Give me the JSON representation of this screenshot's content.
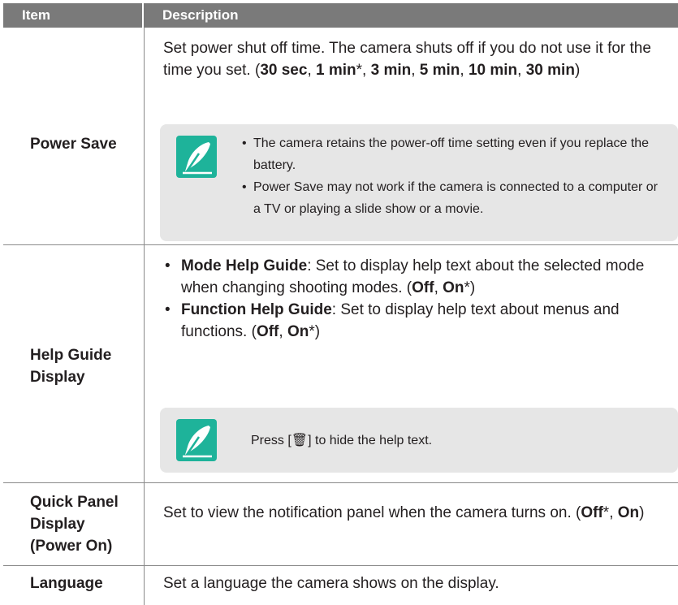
{
  "header": {
    "item": "Item",
    "description": "Description"
  },
  "rows": [
    {
      "label": "Power Save",
      "desc_parts": [
        "Set power shut off time. The camera shuts off if you do not use it for the time you set. (",
        "30 sec",
        ", ",
        "1 min",
        "*, ",
        "3 min",
        ", ",
        "5 min",
        ", ",
        "10 min",
        ", ",
        "30 min",
        ")"
      ],
      "note_items": [
        "The camera retains the power-off time setting even if you replace the battery.",
        "Power Save may not work if the camera is connected to a computer or a TV or playing a slide show or a movie."
      ]
    },
    {
      "label_line1": "Help Guide",
      "label_line2": "Display",
      "bullet1_bold": "Mode Help Guide",
      "bullet1_text": ": Set to display help text about the selected mode when changing shooting modes. (",
      "bullet1_off": "Off",
      "bullet1_sep": ", ",
      "bullet1_on": "On",
      "bullet1_end": "*)",
      "bullet2_bold": "Function Help Guide",
      "bullet2_text": ": Set to display help text about menus and functions. (",
      "bullet2_off": "Off",
      "bullet2_sep": ", ",
      "bullet2_on": "On",
      "bullet2_end": "*)",
      "note_text": "Press [🗑] to hide the help text."
    },
    {
      "label_line1": "Quick Panel",
      "label_line2": "Display",
      "label_line3": "(Power On)",
      "desc_a": "Set to view the notification panel when the camera turns on. (",
      "off": "Off",
      "mid": "*, ",
      "on": "On",
      "end": ")"
    },
    {
      "label": "Language",
      "desc": "Set a language the camera shows on the display."
    }
  ],
  "bullet_glyph": "•",
  "icons": {
    "note": "note-pen-icon",
    "trash": "trash-icon"
  },
  "colors": {
    "header_bg": "#7a7a7a",
    "note_bg": "#e6e6e6",
    "note_icon_bg": "#1eb39a"
  }
}
